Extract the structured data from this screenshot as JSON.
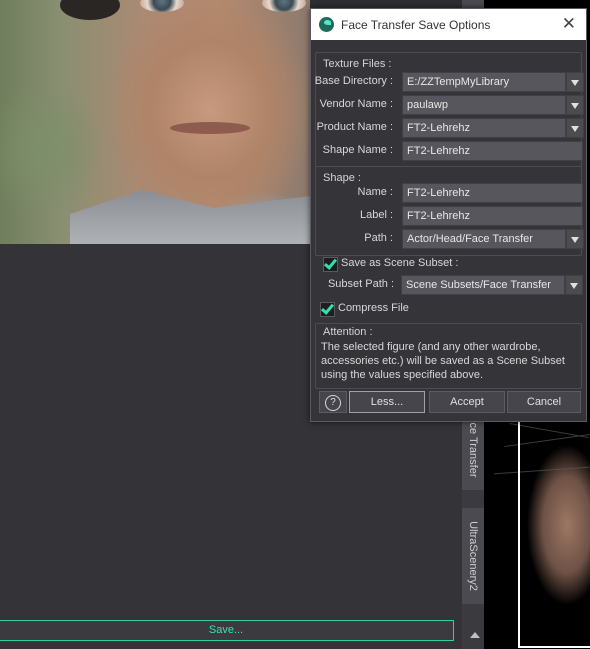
{
  "dialog": {
    "title": "Face Transfer Save Options",
    "close_glyph": "✕",
    "texture_files": {
      "title": "Texture Files :",
      "base_directory_label": "Base Directory :",
      "base_directory_value": "E:/ZZTempMyLibrary",
      "vendor_name_label": "Vendor Name :",
      "vendor_name_value": "paulawp",
      "product_name_label": "Product Name :",
      "product_name_value": "FT2-Lehrehz",
      "shape_name_label": "Shape Name :",
      "shape_name_value": "FT2-Lehrehz"
    },
    "shape": {
      "title": "Shape :",
      "name_label": "Name :",
      "name_value": "FT2-Lehrehz",
      "label_label": "Label :",
      "label_value": "FT2-Lehrehz",
      "path_label": "Path :",
      "path_value": "Actor/Head/Face Transfer"
    },
    "scene_subset": {
      "checkbox_label": "Save as Scene Subset :",
      "checked": true,
      "subset_path_label": "Subset Path :",
      "subset_path_value": "Scene Subsets/Face Transfer",
      "compress_label": "Compress File",
      "compress_checked": true
    },
    "attention": {
      "title": "Attention :",
      "text": "The selected figure (and any other wardrobe, accessories etc.) will be saved as a Scene Subset using the values specified above."
    },
    "buttons": {
      "help": "?",
      "less": "Less...",
      "accept": "Accept",
      "cancel": "Cancel"
    }
  },
  "background": {
    "save_button": "Save...",
    "side_tab_1": "ce Transfer",
    "side_tab_2": "UltraScenery2",
    "accent_color": "#2fe0a8"
  }
}
